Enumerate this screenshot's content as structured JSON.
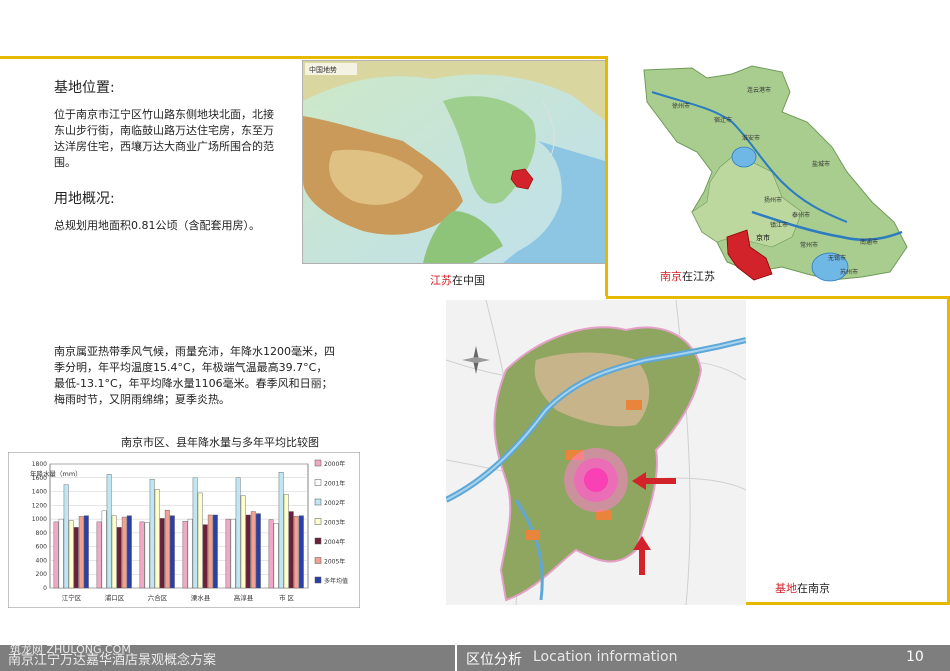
{
  "site": {
    "heading": "基地位置:",
    "text": "位于南京市江宁区竹山路东侧地块北面，北接东山步行街，南临鼓山路万达住宅房，东至万达洋房住宅，西壤万达大商业广场所围合的范围。"
  },
  "land": {
    "heading": "用地概况:",
    "text": "总规划用地面积0.81公顷（含配套用房）。"
  },
  "climate": {
    "text": "南京属亚热带季风气候，雨量充沛，年降水1200毫米，四季分明，年平均温度15.4°C，年极端气温最高39.7°C，最低-13.1°C，年平均降水量1106毫米。春季风和日丽；梅雨时节，又阴雨绵绵；夏季炎热。"
  },
  "map_china": {
    "label_title": "中国地势",
    "caption_red": "江苏",
    "caption_rest": "在中国"
  },
  "map_jiangsu": {
    "caption_red": "南京",
    "caption_rest": "在江苏",
    "cities": [
      "连云港市",
      "宿迁市",
      "淮安市",
      "盐城市",
      "泰州市",
      "扬州市",
      "镇江市",
      "南通市",
      "常州市",
      "无锡市",
      "苏州市",
      "徐州市",
      "京市"
    ]
  },
  "map_nanjing": {
    "caption_red": "基地",
    "caption_rest": "在南京"
  },
  "chart_data": {
    "type": "bar",
    "title": "南京市区、县年降水量与多年平均比较图",
    "ylabel": "年降水量（mm）",
    "ylim": [
      0,
      1800
    ],
    "yticks": [
      0,
      200,
      400,
      600,
      800,
      1000,
      1200,
      1400,
      1600,
      1800
    ],
    "categories": [
      "江宁区",
      "浦口区",
      "六合区",
      "溧水县",
      "高淳县",
      "市  区"
    ],
    "series": [
      {
        "name": "2000年",
        "color": "#f2a7c4",
        "values": [
          960,
          960,
          960,
          970,
          1000,
          990
        ]
      },
      {
        "name": "2001年",
        "color": "#ffffff",
        "values": [
          1000,
          1120,
          950,
          1000,
          1000,
          940
        ]
      },
      {
        "name": "2002年",
        "color": "#bfe6f3",
        "values": [
          1500,
          1650,
          1580,
          1600,
          1600,
          1680
        ]
      },
      {
        "name": "2003年",
        "color": "#ffffcc",
        "values": [
          980,
          1050,
          1430,
          1380,
          1340,
          1360
        ]
      },
      {
        "name": "2004年",
        "color": "#6b1f3a",
        "values": [
          880,
          880,
          1010,
          920,
          1060,
          1110
        ]
      },
      {
        "name": "2005年",
        "color": "#f4a090",
        "values": [
          1040,
          1030,
          1130,
          1060,
          1110,
          1040
        ]
      },
      {
        "name": "多年均值",
        "color": "#2a3fa8",
        "values": [
          1050,
          1050,
          1050,
          1060,
          1080,
          1050
        ]
      }
    ]
  },
  "footer": {
    "left": "南京江宁万达嘉华酒店景观概念方案",
    "watermark": "筑龙网 ZHULONG.COM",
    "section_cn": "区位分析",
    "section_en": "Location information",
    "page": "10"
  }
}
